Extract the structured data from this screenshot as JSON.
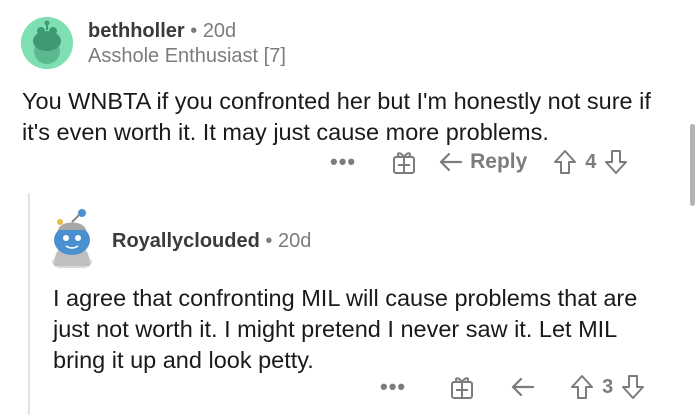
{
  "comment": {
    "username": "bethholler",
    "separator": "•",
    "age": "20d",
    "flair": "Asshole Enthusiast [7]",
    "body": "You WNBTA if you confronted her but I'm honestly not sure if it's even worth it. It may just cause more problems.",
    "actions": {
      "more": "•••",
      "reply_label": "Reply",
      "score": "4"
    }
  },
  "reply": {
    "username": "Royallyclouded",
    "separator": "•",
    "age": "20d",
    "body": "I agree that confronting MIL will cause problems that are just not worth it. I might pretend I never saw it. Let MIL bring it up and look petty.",
    "actions": {
      "more": "•••",
      "score": "3"
    }
  },
  "colors": {
    "avatar1_bg": "#7ee0b2",
    "avatar2_body": "#4a8fd0",
    "meta_gray": "#7c7c7c",
    "text": "#1a1a1b"
  },
  "icons": {
    "more": "more-options-icon",
    "award": "award-icon",
    "reply": "reply-arrow-icon",
    "upvote": "upvote-icon",
    "downvote": "downvote-icon"
  }
}
